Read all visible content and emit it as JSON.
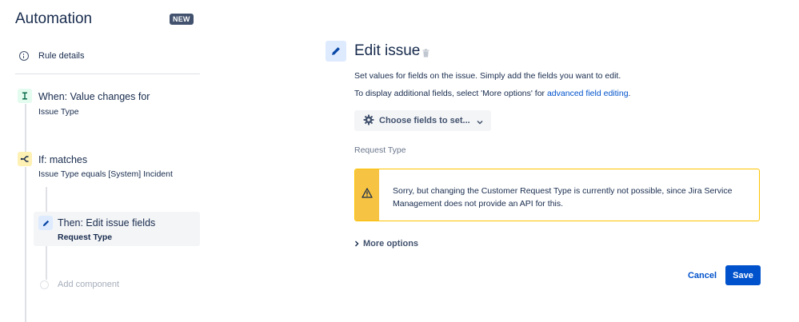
{
  "sidebar": {
    "title": "Automation",
    "badge": "NEW",
    "rule_details": "Rule details",
    "components": [
      {
        "kind": "trigger",
        "title": "When: Value changes for",
        "subtitle": "Issue Type",
        "color": "#e3fcef",
        "icon": "trigger-icon"
      },
      {
        "kind": "condition",
        "title": "If: matches",
        "subtitle": "Issue Type equals [System] Incident",
        "color": "#fff0b3",
        "icon": "branch-icon"
      },
      {
        "kind": "action",
        "title": "Then: Edit issue fields",
        "subtitle": "Request Type",
        "color": "#deebff",
        "icon": "pencil-icon",
        "selected": true
      }
    ],
    "add_component": "Add component"
  },
  "main": {
    "title": "Edit issue",
    "description": "Set values for fields on the issue. Simply add the fields you want to edit.",
    "additional_prefix": "To display additional fields, select 'More options' for ",
    "additional_link": "advanced field editing",
    "additional_suffix": ".",
    "choose_fields": "Choose fields to set...",
    "field_label": "Request Type",
    "warning": "Sorry, but changing the Customer Request Type is currently not possible, since Jira Service Management does not provide an API for this.",
    "more_options": "More options",
    "cancel": "Cancel",
    "save": "Save"
  },
  "colors": {
    "accent": "#0052cc",
    "warning_stripe": "#f6c342",
    "warning_border": "#ffc400",
    "new_badge": "#42526e"
  }
}
